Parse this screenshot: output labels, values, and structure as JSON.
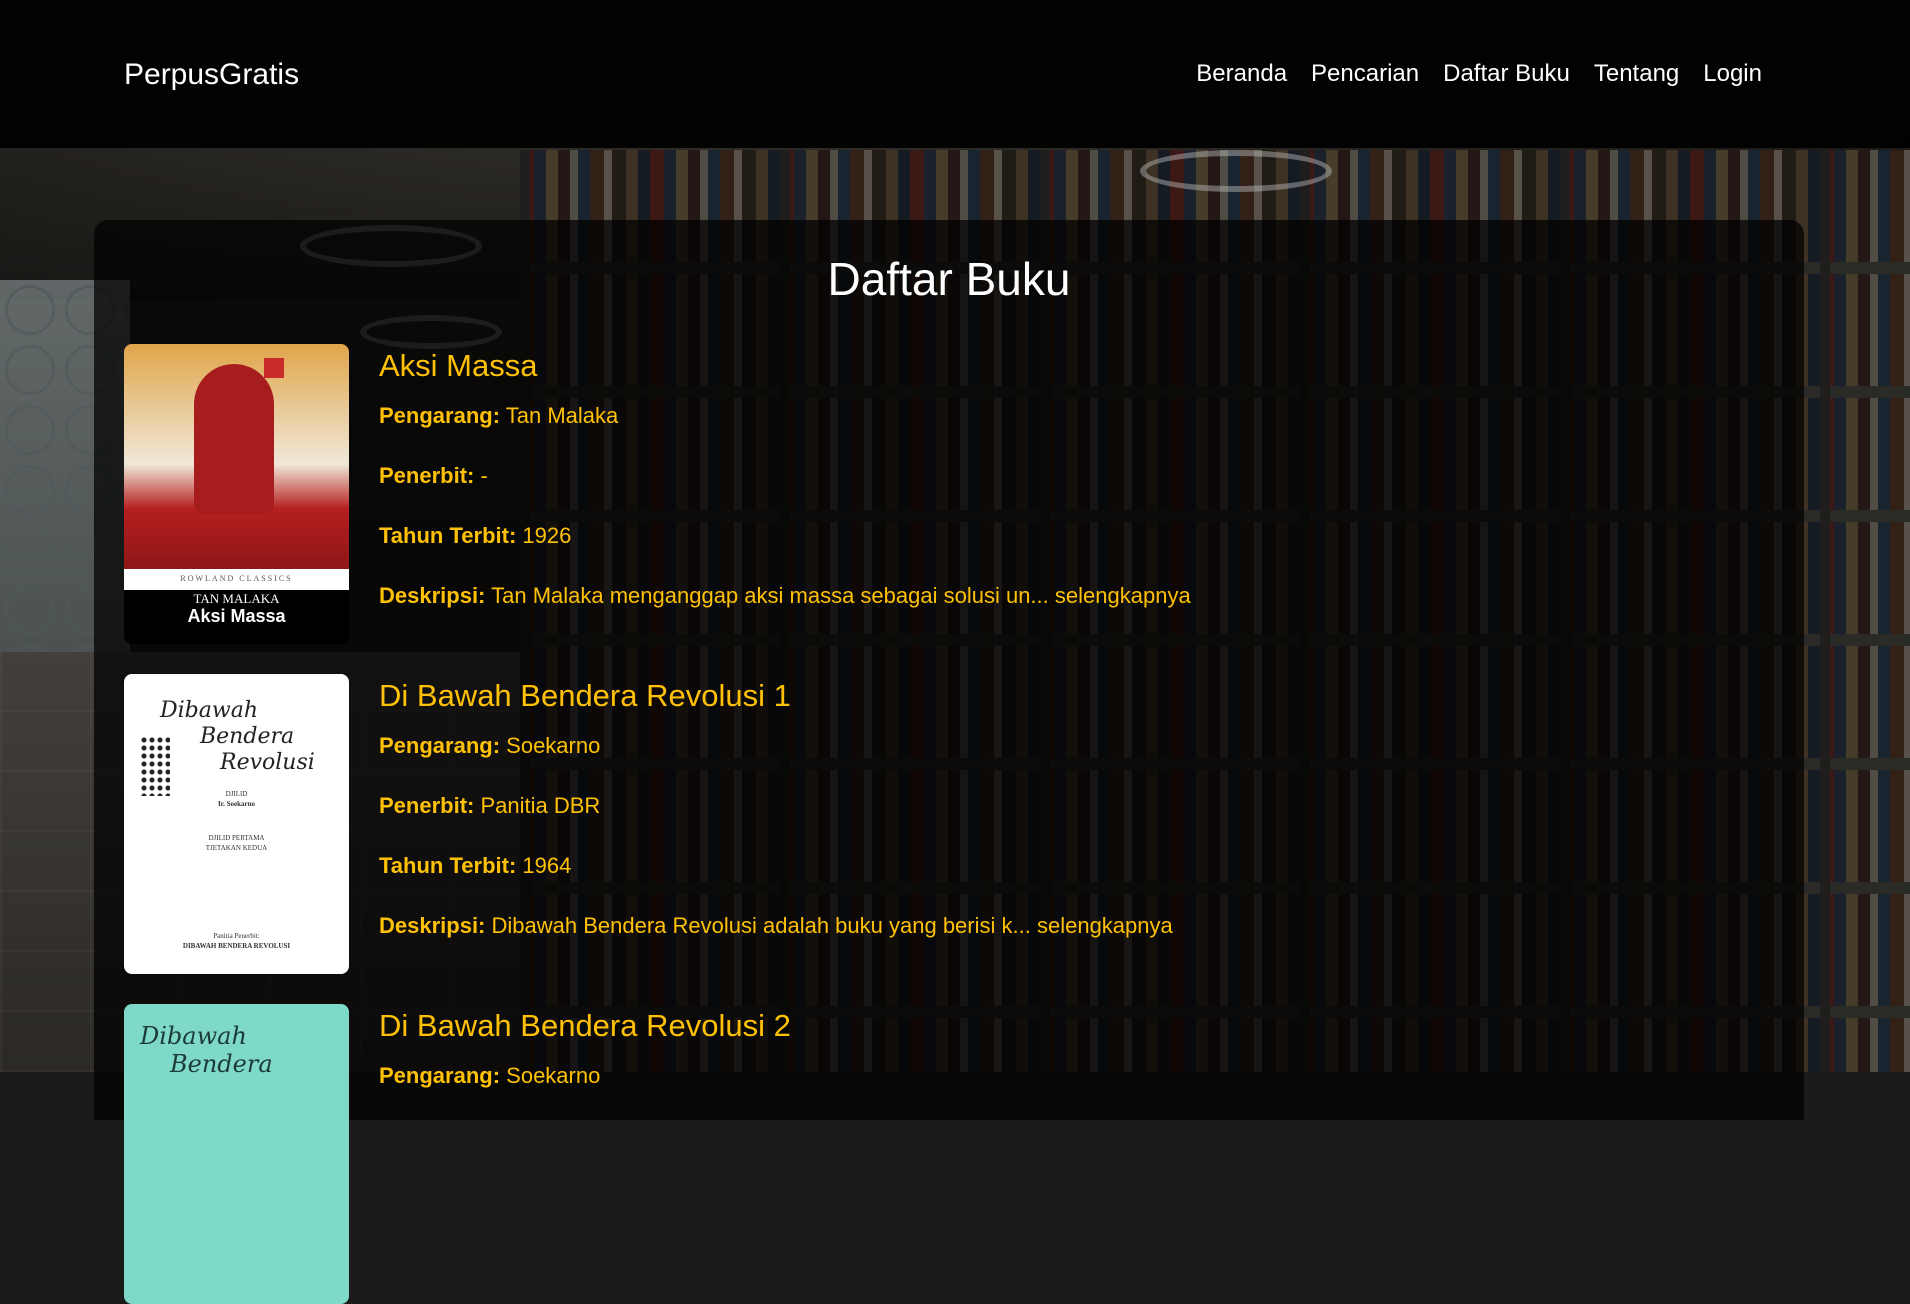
{
  "navbar": {
    "brand": "PerpusGratis",
    "links": [
      "Beranda",
      "Pencarian",
      "Daftar Buku",
      "Tentang",
      "Login"
    ]
  },
  "page": {
    "title": "Daftar Buku"
  },
  "labels": {
    "author": "Pengarang:",
    "publisher": "Penerbit:",
    "year": "Tahun Terbit:",
    "description": "Deskripsi:",
    "more": "selengkapnya"
  },
  "books": [
    {
      "title": "Aksi Massa",
      "author": "Tan Malaka",
      "publisher": "-",
      "year": "1926",
      "description": "Tan Malaka menganggap aksi massa sebagai solusi un...",
      "cover": {
        "series": "ROWLAND CLASSICS",
        "author": "TAN MALAKA",
        "title": "Aksi Massa"
      }
    },
    {
      "title": "Di Bawah Bendera Revolusi 1",
      "author": "Soekarno",
      "publisher": "Panitia DBR",
      "year": "1964",
      "description": "Dibawah Bendera Revolusi adalah buku yang berisi k...",
      "cover": {
        "script_line1": "Dibawah",
        "script_line2": "Bendera",
        "script_line3": "Revolusi",
        "jilid": "DJILID",
        "author": "Ir. Soekarno",
        "edition_line1": "DJILID PERTAMA",
        "edition_line2": "TJETAKAN KEDUA",
        "publisher_line1": "Panitia Penerbit:",
        "publisher_line2": "DIBAWAH BENDERA REVOLUSI"
      }
    },
    {
      "title": "Di Bawah Bendera Revolusi 2",
      "author": "Soekarno",
      "cover": {
        "script_line1": "Dibawah",
        "script_line2": "Bendera"
      }
    }
  ],
  "colors": {
    "accent": "#ffc107",
    "navbar": "#000000",
    "text": "#ffffff"
  }
}
